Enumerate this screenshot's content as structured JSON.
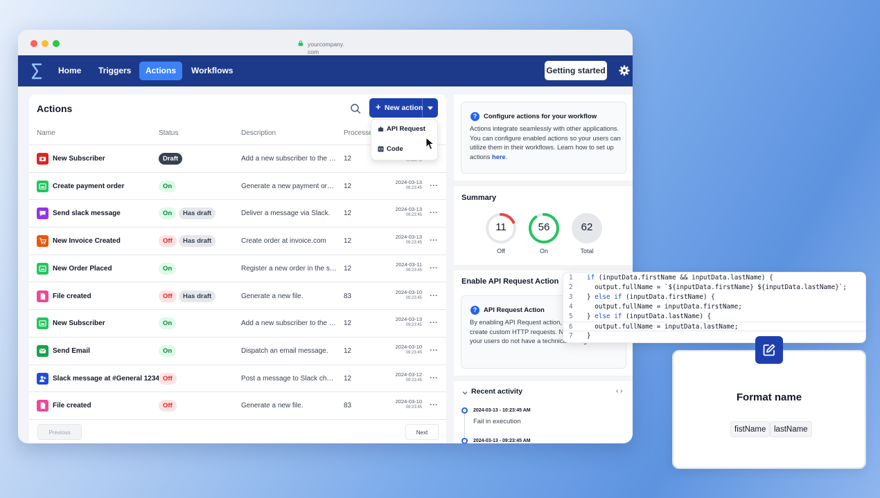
{
  "browser": {
    "url_line1": "yourcompany.",
    "url_line2": "com"
  },
  "nav": {
    "items": [
      {
        "label": "Home"
      },
      {
        "label": "Triggers"
      },
      {
        "label": "Actions",
        "active": true
      },
      {
        "label": "Workflows"
      }
    ],
    "getting_started": "Getting started"
  },
  "actions": {
    "title": "Actions",
    "new_action_label": "New action",
    "columns": [
      "Name",
      "Status",
      "Description",
      "Processe"
    ],
    "dropdown": [
      {
        "label": "API Request",
        "icon": "puzzle-icon"
      },
      {
        "label": "Code",
        "icon": "code-icon"
      }
    ],
    "rows": [
      {
        "name": "New Subscriber",
        "icon": "camera-icon",
        "icon_color": "#dc2626",
        "status": "Draft",
        "status_type": "draft",
        "has_draft": false,
        "desc": "Add a new subscriber to the mailing list",
        "processed": "12",
        "date": "",
        "time": "09:23:45"
      },
      {
        "name": "Create payment order",
        "icon": "payment-icon",
        "icon_color": "#22c55e",
        "status": "On",
        "status_type": "on",
        "has_draft": false,
        "desc": "Generate a new payment order in the system",
        "processed": "12",
        "date": "2024-03-13",
        "time": "09:23:45"
      },
      {
        "name": "Send slack message",
        "icon": "chat-icon",
        "icon_color": "#9333ea",
        "status": "On",
        "status_type": "on",
        "has_draft": true,
        "desc": "Deliver a message via Slack.",
        "processed": "12",
        "date": "2024-03-13",
        "time": "09:23:45"
      },
      {
        "name": "New Invoice Created",
        "icon": "cart-icon",
        "icon_color": "#ea580c",
        "status": "Off",
        "status_type": "off",
        "has_draft": true,
        "desc": "Create order at invoice.com",
        "processed": "12",
        "date": "2024-03-13",
        "time": "09:23:45"
      },
      {
        "name": "New Order Placed",
        "icon": "payment-icon",
        "icon_color": "#22c55e",
        "status": "On",
        "status_type": "on",
        "has_draft": false,
        "desc": "Register a new order in the system",
        "processed": "12",
        "date": "2024-03-11",
        "time": "09:23:45"
      },
      {
        "name": "File created",
        "icon": "file-icon",
        "icon_color": "#ec4899",
        "status": "Off",
        "status_type": "off",
        "has_draft": true,
        "desc": "Generate a new file.",
        "processed": "83",
        "date": "2024-03-10",
        "time": "09:23:45"
      },
      {
        "name": "New Subscriber",
        "icon": "payment-icon",
        "icon_color": "#22c55e",
        "status": "On",
        "status_type": "on",
        "has_draft": false,
        "desc": "Add a new subscriber to the mailing list",
        "processed": "12",
        "date": "2024-03-13",
        "time": "09:23:45"
      },
      {
        "name": "Send Email",
        "icon": "mail-icon",
        "icon_color": "#16a34a",
        "status": "On",
        "status_type": "on",
        "has_draft": false,
        "desc": "Dispatch an email message.",
        "processed": "12",
        "date": "2024-03-10",
        "time": "09:23:45"
      },
      {
        "name": "Slack message at #General 1234",
        "icon": "user-add-icon",
        "icon_color": "#1d4ed8",
        "status": "Off",
        "status_type": "off",
        "has_draft": false,
        "desc": "Post a message to Slack channel #General",
        "processed": "12",
        "date": "2024-03-12",
        "time": "09:23:45"
      },
      {
        "name": "File created",
        "icon": "file-icon",
        "icon_color": "#ec4899",
        "status": "Off",
        "status_type": "off",
        "has_draft": false,
        "desc": "Generate a new file.",
        "processed": "83",
        "date": "2024-03-10",
        "time": "09:23:45"
      }
    ],
    "has_draft_label": "Has draft",
    "prev_page": "Previous Page",
    "next_page": "Next Page"
  },
  "info": {
    "title": "Configure actions for your workflow",
    "text": "Actions integrate seamlessly with other applications. You can configure enabled actions so your users can utilize them in their workflows. Learn how to set up actions ",
    "link": "here",
    "link_suffix": "."
  },
  "summary": {
    "title": "Summary",
    "items": [
      {
        "value": "11",
        "label": "Off",
        "fraction": 0.18,
        "color": "#ef4444"
      },
      {
        "value": "56",
        "label": "On",
        "fraction": 0.9,
        "color": "#22c55e"
      },
      {
        "value": "62",
        "label": "Total",
        "fraction": 1.0,
        "color": "#e5e7eb"
      }
    ]
  },
  "api": {
    "section_title": "Enable API Request Action",
    "title": "API Request Action",
    "text": "By enabling API Request action, you allow users to create custom HTTP requests. Not recommended if your users do not have a technical background."
  },
  "recent": {
    "title": "Recent activity",
    "arrows": "‹ ›",
    "events": [
      {
        "time": "2024-03-13 - 10:23:45 AM",
        "text": "Fail in execution"
      },
      {
        "time": "2024-03-13 - 09:23:45 AM",
        "text": ""
      }
    ]
  },
  "code": {
    "lines": [
      {
        "n": "1",
        "code": "if (inputData.firstName && inputData.lastName) {"
      },
      {
        "n": "2",
        "code": "  output.fullName = `${inputData.firstName} ${inputData.lastName}`;"
      },
      {
        "n": "3",
        "code": "} else if (inputData.firstName) {"
      },
      {
        "n": "4",
        "code": "  output.fullName = inputData.firstName;"
      },
      {
        "n": "5",
        "code": "} else if (inputData.lastName) {"
      },
      {
        "n": "6",
        "code": "  output.fullName = inputData.lastName;"
      },
      {
        "n": "7",
        "code": "}"
      }
    ]
  },
  "format": {
    "title": "Format name",
    "chips": [
      "fistName",
      "lastName"
    ]
  }
}
